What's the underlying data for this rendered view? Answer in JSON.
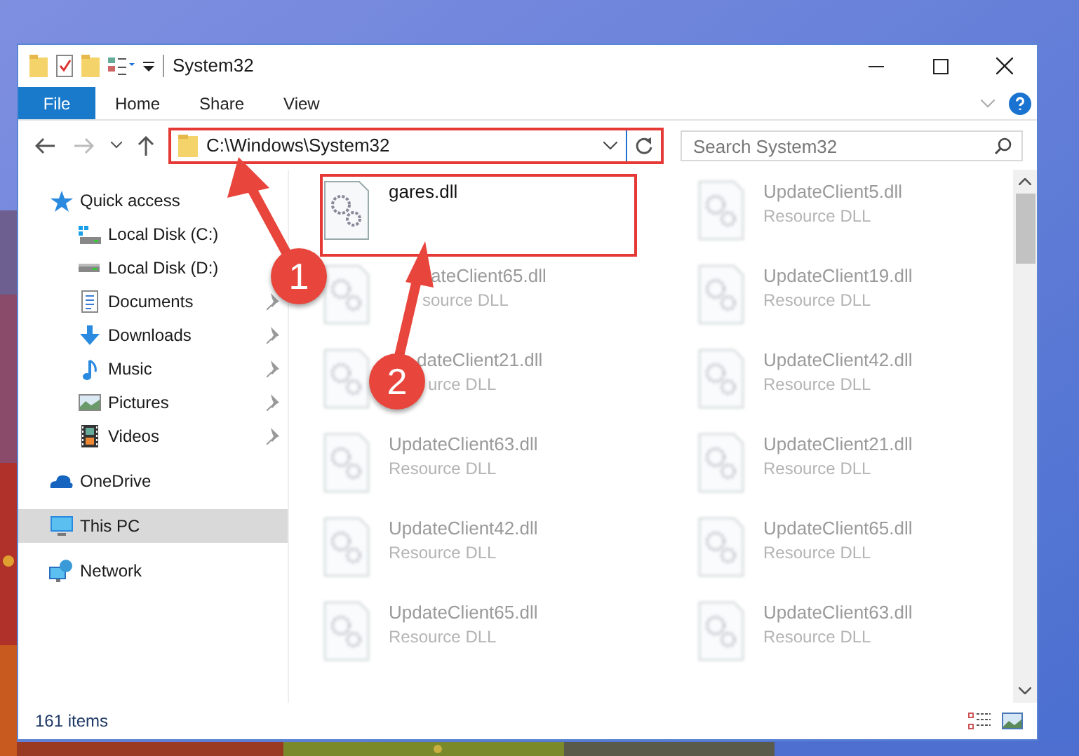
{
  "window": {
    "title": "System32"
  },
  "ribbon_tabs": [
    {
      "label": "File",
      "kind": "file"
    },
    {
      "label": "Home",
      "kind": "tab"
    },
    {
      "label": "Share",
      "kind": "tab"
    },
    {
      "label": "View",
      "kind": "tab"
    }
  ],
  "address_bar": {
    "path": "C:\\Windows\\System32",
    "marked": true
  },
  "search": {
    "placeholder": "Search System32"
  },
  "navigation": [
    {
      "label": "Quick access",
      "kind": "star",
      "selected": false,
      "children": [
        {
          "label": "Local Disk (C:)",
          "kind": "system-disk",
          "pinned": false
        },
        {
          "label": "Local Disk (D:)",
          "kind": "disk",
          "pinned": false
        },
        {
          "label": "Documents",
          "kind": "document",
          "pinned": true
        },
        {
          "label": "Downloads",
          "kind": "download",
          "pinned": true
        },
        {
          "label": "Music",
          "kind": "music",
          "pinned": true
        },
        {
          "label": "Pictures",
          "kind": "pictures",
          "pinned": true
        },
        {
          "label": "Videos",
          "kind": "videos",
          "pinned": true
        }
      ]
    },
    {
      "label": "OneDrive",
      "kind": "cloud",
      "selected": false
    },
    {
      "label": "This PC",
      "kind": "pc",
      "selected": true
    },
    {
      "label": "Network",
      "kind": "network",
      "selected": false
    }
  ],
  "files": [
    {
      "name": "gares.dll",
      "marked": true,
      "blurred": false
    },
    {
      "name": "UpdateClient5.dll",
      "type": "Resource DLL",
      "marked": false,
      "blurred": true
    },
    {
      "name": "ateClient65.dll",
      "type": "source DLL",
      "marked": false,
      "blurred": true
    },
    {
      "name": "UpdateClient19.dll",
      "type": "Resource DLL",
      "marked": false,
      "blurred": true
    },
    {
      "name": "dateClient21.dll",
      "type": "urce DLL",
      "marked": false,
      "blurred": true
    },
    {
      "name": "UpdateClient42.dll",
      "type": "Resource DLL",
      "marked": false,
      "blurred": true
    },
    {
      "name": "UpdateClient63.dll",
      "type": "Resource DLL",
      "marked": false,
      "blurred": true
    },
    {
      "name": "UpdateClient21.dll",
      "type": "Resource DLL",
      "marked": false,
      "blurred": true
    },
    {
      "name": "UpdateClient42.dll",
      "type": "Resource DLL",
      "marked": false,
      "blurred": true
    },
    {
      "name": "UpdateClient65.dll",
      "type": "Resource DLL",
      "marked": false,
      "blurred": true
    },
    {
      "name": "UpdateClient65.dll",
      "type": "Resource DLL",
      "marked": false,
      "blurred": true
    },
    {
      "name": "UpdateClient63.dll",
      "type": "Resource DLL",
      "marked": false,
      "blurred": true
    }
  ],
  "status_bar": {
    "item_count": "161 items"
  },
  "annotations": [
    {
      "label": "1"
    },
    {
      "label": "2"
    }
  ]
}
